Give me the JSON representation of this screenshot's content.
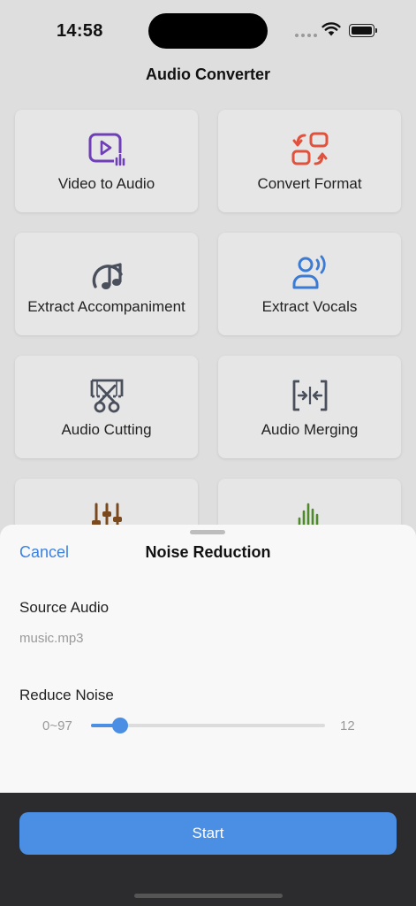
{
  "status_bar": {
    "time": "14:58"
  },
  "app": {
    "title": "Audio Converter"
  },
  "tools": [
    {
      "label": "Video to Audio",
      "icon": "video-to-audio-icon",
      "color": "#6f3fb8"
    },
    {
      "label": "Convert Format",
      "icon": "convert-format-icon",
      "color": "#e0523c"
    },
    {
      "label": "Extract Accompaniment",
      "icon": "music-note-icon",
      "color": "#4a4f5c"
    },
    {
      "label": "Extract Vocals",
      "icon": "vocals-icon",
      "color": "#3a7bd5"
    },
    {
      "label": "Audio Cutting",
      "icon": "scissors-icon",
      "color": "#4a4f5c"
    },
    {
      "label": "Audio Merging",
      "icon": "merge-icon",
      "color": "#4a4f5c"
    },
    {
      "label": "",
      "icon": "equalizer-icon",
      "color": "#7a4a1e"
    },
    {
      "label": "",
      "icon": "waveform-icon",
      "color": "#4f8a2a"
    }
  ],
  "sheet": {
    "cancel_label": "Cancel",
    "title": "Noise Reduction",
    "source_label": "Source Audio",
    "source_file": "music.mp3",
    "noise_label": "Reduce Noise",
    "range_text": "0~97",
    "value_text": "12",
    "slider": {
      "min": 0,
      "max": 97,
      "value": 12
    },
    "accent_color": "#4a8fe3"
  },
  "footer": {
    "start_label": "Start"
  }
}
